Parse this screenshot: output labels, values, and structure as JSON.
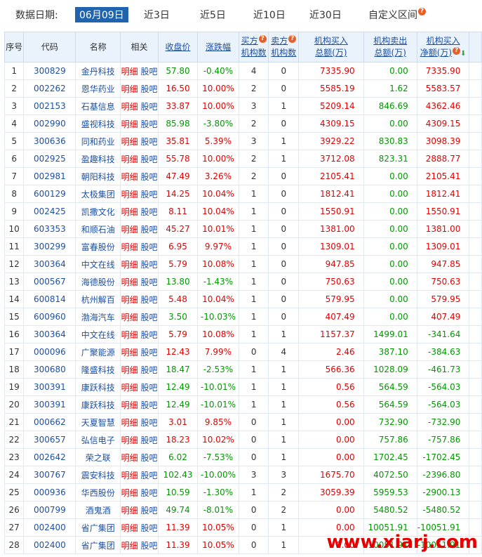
{
  "filter": {
    "label": "数据日期:",
    "options": [
      "06月09日",
      "近3日",
      "近5日",
      "近10日",
      "近30日",
      "自定义区间"
    ],
    "active_index": 0,
    "help_icon": "?"
  },
  "table": {
    "headers": {
      "idx": "序号",
      "code": "代码",
      "name": "名称",
      "rel": "相关",
      "close": "收盘价",
      "change": "涨跌幅",
      "buy_cnt_1": "买方",
      "buy_cnt_2": "机构数",
      "sell_cnt_1": "卖方",
      "sell_cnt_2": "机构数",
      "buy_amt_1": "机构买入",
      "buy_amt_2": "总额(万)",
      "sell_amt_1": "机构卖出",
      "sell_amt_2": "总额(万)",
      "net_1": "机构买入",
      "net_2": "净额(万)"
    },
    "rel_detail": "明细",
    "rel_forum": "股吧",
    "rows": [
      {
        "idx": "1",
        "code": "300829",
        "name": "金丹科技",
        "close": "57.80",
        "change": "-0.40%",
        "bc": "4",
        "sc": "0",
        "ba": "7335.90",
        "sa": "0.00",
        "net": "7335.90"
      },
      {
        "idx": "2",
        "code": "002262",
        "name": "恩华药业",
        "close": "16.50",
        "change": "10.00%",
        "bc": "2",
        "sc": "0",
        "ba": "5585.19",
        "sa": "1.62",
        "net": "5583.57"
      },
      {
        "idx": "3",
        "code": "002153",
        "name": "石基信息",
        "close": "33.87",
        "change": "10.00%",
        "bc": "3",
        "sc": "1",
        "ba": "5209.14",
        "sa": "846.69",
        "net": "4362.46"
      },
      {
        "idx": "4",
        "code": "002990",
        "name": "盛视科技",
        "close": "85.98",
        "change": "-3.80%",
        "bc": "2",
        "sc": "0",
        "ba": "4309.15",
        "sa": "0.00",
        "net": "4309.15"
      },
      {
        "idx": "5",
        "code": "300636",
        "name": "同和药业",
        "close": "35.81",
        "change": "5.39%",
        "bc": "3",
        "sc": "1",
        "ba": "3929.22",
        "sa": "830.83",
        "net": "3098.39"
      },
      {
        "idx": "6",
        "code": "002925",
        "name": "盈趣科技",
        "close": "55.78",
        "change": "10.00%",
        "bc": "2",
        "sc": "1",
        "ba": "3712.08",
        "sa": "823.31",
        "net": "2888.77"
      },
      {
        "idx": "7",
        "code": "002981",
        "name": "朝阳科技",
        "close": "47.49",
        "change": "3.26%",
        "bc": "2",
        "sc": "0",
        "ba": "2105.41",
        "sa": "0.00",
        "net": "2105.41"
      },
      {
        "idx": "8",
        "code": "600129",
        "name": "太极集团",
        "close": "14.25",
        "change": "10.04%",
        "bc": "1",
        "sc": "0",
        "ba": "1812.41",
        "sa": "0.00",
        "net": "1812.41"
      },
      {
        "idx": "9",
        "code": "002425",
        "name": "凯撒文化",
        "close": "8.11",
        "change": "10.04%",
        "bc": "1",
        "sc": "0",
        "ba": "1550.91",
        "sa": "0.00",
        "net": "1550.91"
      },
      {
        "idx": "10",
        "code": "603353",
        "name": "和顺石油",
        "close": "45.27",
        "change": "10.01%",
        "bc": "1",
        "sc": "0",
        "ba": "1381.00",
        "sa": "0.00",
        "net": "1381.00"
      },
      {
        "idx": "11",
        "code": "300299",
        "name": "富春股份",
        "close": "6.95",
        "change": "9.97%",
        "bc": "1",
        "sc": "0",
        "ba": "1309.01",
        "sa": "0.00",
        "net": "1309.01"
      },
      {
        "idx": "12",
        "code": "300364",
        "name": "中文在线",
        "close": "5.79",
        "change": "10.08%",
        "bc": "1",
        "sc": "0",
        "ba": "947.85",
        "sa": "0.00",
        "net": "947.85"
      },
      {
        "idx": "13",
        "code": "000567",
        "name": "海德股份",
        "close": "13.80",
        "change": "-1.43%",
        "bc": "1",
        "sc": "0",
        "ba": "750.63",
        "sa": "0.00",
        "net": "750.63"
      },
      {
        "idx": "14",
        "code": "600814",
        "name": "杭州解百",
        "close": "5.48",
        "change": "10.04%",
        "bc": "1",
        "sc": "0",
        "ba": "579.95",
        "sa": "0.00",
        "net": "579.95"
      },
      {
        "idx": "15",
        "code": "600960",
        "name": "渤海汽车",
        "close": "3.50",
        "change": "-10.03%",
        "bc": "1",
        "sc": "0",
        "ba": "407.49",
        "sa": "0.00",
        "net": "407.49"
      },
      {
        "idx": "16",
        "code": "300364",
        "name": "中文在线",
        "close": "5.79",
        "change": "10.08%",
        "bc": "1",
        "sc": "1",
        "ba": "1157.37",
        "sa": "1499.01",
        "net": "-341.64"
      },
      {
        "idx": "17",
        "code": "000096",
        "name": "广聚能源",
        "close": "12.43",
        "change": "7.99%",
        "bc": "0",
        "sc": "4",
        "ba": "2.46",
        "sa": "387.10",
        "net": "-384.63"
      },
      {
        "idx": "18",
        "code": "300680",
        "name": "隆盛科技",
        "close": "18.47",
        "change": "-2.53%",
        "bc": "1",
        "sc": "1",
        "ba": "566.36",
        "sa": "1028.09",
        "net": "-461.73"
      },
      {
        "idx": "19",
        "code": "300391",
        "name": "康跃科技",
        "close": "12.49",
        "change": "-10.01%",
        "bc": "1",
        "sc": "1",
        "ba": "0.56",
        "sa": "564.59",
        "net": "-564.03"
      },
      {
        "idx": "20",
        "code": "300391",
        "name": "康跃科技",
        "close": "12.49",
        "change": "-10.01%",
        "bc": "1",
        "sc": "1",
        "ba": "0.56",
        "sa": "564.59",
        "net": "-564.03"
      },
      {
        "idx": "21",
        "code": "000662",
        "name": "天夏智慧",
        "close": "3.01",
        "change": "9.85%",
        "bc": "0",
        "sc": "1",
        "ba": "0.00",
        "sa": "732.90",
        "net": "-732.90"
      },
      {
        "idx": "22",
        "code": "300657",
        "name": "弘信电子",
        "close": "18.23",
        "change": "10.02%",
        "bc": "0",
        "sc": "1",
        "ba": "0.00",
        "sa": "757.86",
        "net": "-757.86"
      },
      {
        "idx": "23",
        "code": "002642",
        "name": "荣之联",
        "close": "6.02",
        "change": "-7.53%",
        "bc": "0",
        "sc": "1",
        "ba": "0.00",
        "sa": "1702.45",
        "net": "-1702.45"
      },
      {
        "idx": "24",
        "code": "300767",
        "name": "震安科技",
        "close": "102.43",
        "change": "-10.00%",
        "bc": "3",
        "sc": "3",
        "ba": "1675.70",
        "sa": "4072.50",
        "net": "-2396.80"
      },
      {
        "idx": "25",
        "code": "000936",
        "name": "华西股份",
        "close": "10.59",
        "change": "-1.30%",
        "bc": "1",
        "sc": "2",
        "ba": "3059.39",
        "sa": "5959.53",
        "net": "-2900.13"
      },
      {
        "idx": "26",
        "code": "000799",
        "name": "酒鬼酒",
        "close": "49.74",
        "change": "-8.01%",
        "bc": "0",
        "sc": "2",
        "ba": "0.00",
        "sa": "5480.52",
        "net": "-5480.52"
      },
      {
        "idx": "27",
        "code": "002400",
        "name": "省广集团",
        "close": "11.39",
        "change": "10.05%",
        "bc": "0",
        "sc": "1",
        "ba": "0.00",
        "sa": "10051.91",
        "net": "-10051.91"
      },
      {
        "idx": "28",
        "code": "002400",
        "name": "省广集团",
        "close": "11.39",
        "change": "10.05%",
        "bc": "0",
        "sc": "1",
        "ba": "0.00",
        "sa": "10051.91",
        "net": "-10051.91"
      }
    ]
  },
  "watermark": "www.xiarj.com",
  "colors": {
    "up": "#e60000",
    "down": "#009900",
    "link": "#1e50a2",
    "header_bg": "#eaf2fb",
    "active_bg": "#1f64ad"
  }
}
